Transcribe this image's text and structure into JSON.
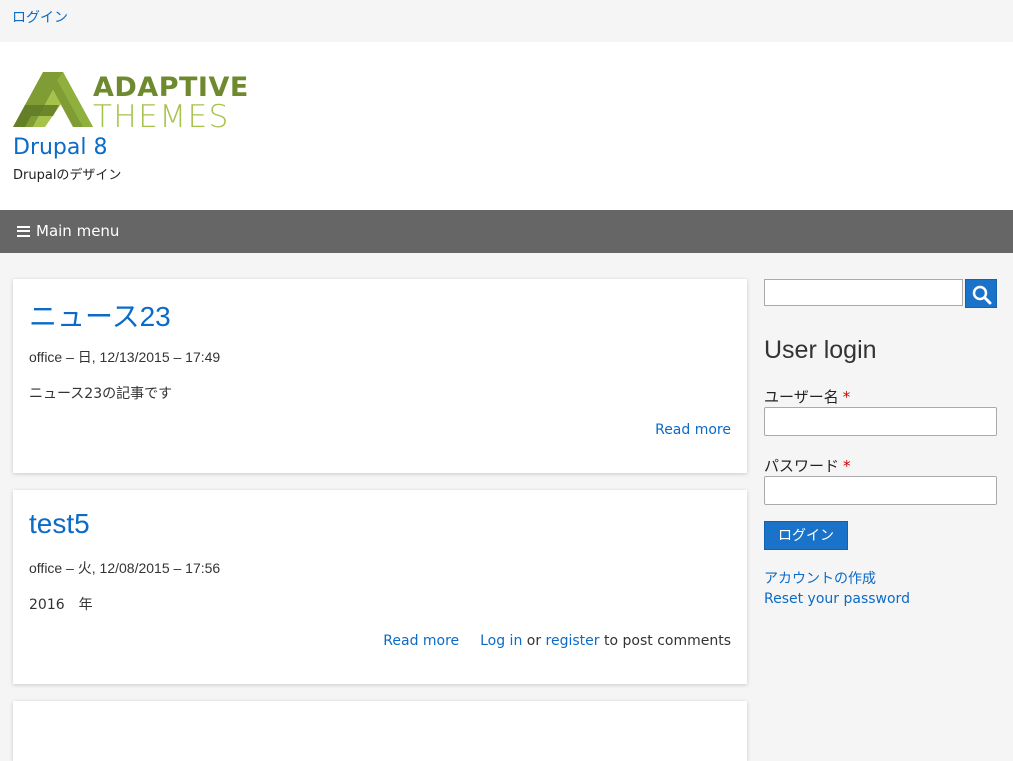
{
  "topbar": {
    "login_link": "ログイン"
  },
  "branding": {
    "logo_word1": "ADAPTIVE",
    "logo_word2": "THEMES",
    "site_name": "Drupal 8",
    "slogan": "Drupalのデザイン"
  },
  "menu": {
    "toggle_label": "Main menu"
  },
  "articles": [
    {
      "title": "ニュース23",
      "meta": "office – 日, 12/13/2015 – 17:49",
      "body": "ニュース23の記事です",
      "read_more": "Read more"
    },
    {
      "title": "test5",
      "meta": "office – 火, 12/08/2015 – 17:56",
      "body": "2016　年",
      "read_more": "Read more",
      "log_in": "Log in",
      "or": "or",
      "register": "register",
      "post_comments": "to post comments"
    }
  ],
  "partial_third_title": "",
  "sidebar": {
    "search_placeholder": "",
    "login_title": "User login",
    "username_label": "ユーザー名",
    "password_label": "パスワード",
    "required_marker": "*",
    "login_button": "ログイン",
    "create_account": "アカウントの作成",
    "reset_password": "Reset your password"
  },
  "colors": {
    "accent": "#1a73c9",
    "link": "#0b6bc7",
    "menubar": "#666666",
    "logo_green_dark": "#6f8a2e",
    "logo_green_light": "#a6c24a"
  }
}
